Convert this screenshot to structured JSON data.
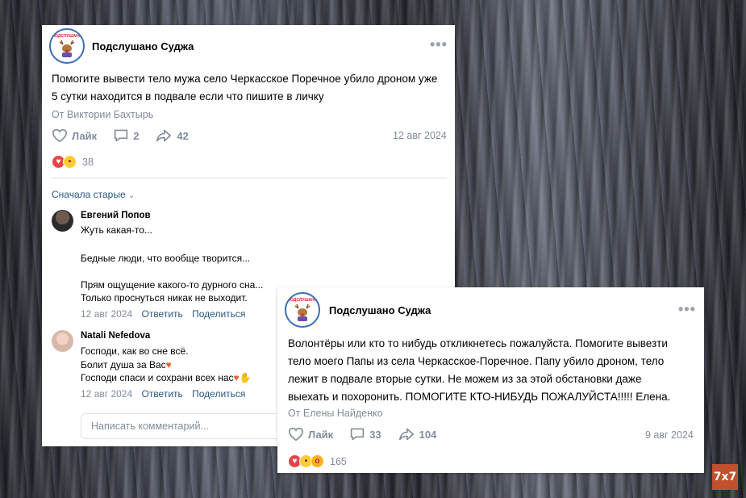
{
  "post1": {
    "group_name": "Подслушано Суджа",
    "logo_text": "ПОДСЛУШАНО",
    "text_lines": [
      "Помогите вывести тело мужа село Черкасское Поречное убило дроном уже",
      "5 сутки находится в подвале если что пишите в личку"
    ],
    "from": "От Виктории Бахтырь",
    "like_label": "Лайк",
    "comments": "2",
    "shares": "42",
    "date": "12 авг 2024",
    "reaction_count": "38",
    "sort_label": "Сначала старые",
    "comment_items": [
      {
        "author": "Евгений Попов",
        "lines": [
          "Жуть какая-то...",
          "",
          "Бедные люди, что вообще творится...",
          "",
          "Прям ощущение какого-то дурного сна...",
          "Только проснуться никак не выходит."
        ],
        "date": "12 авг 2024",
        "reply": "Ответить",
        "share": "Поделиться"
      },
      {
        "author": "Natali Nefedova",
        "lines": [
          "Господи, как во сне всё.",
          "Болит душа за Вас",
          "Господи спаси и сохрани всех нас"
        ],
        "date": "12 авг 2024",
        "reply": "Ответить",
        "share": "Поделиться"
      }
    ],
    "comment_placeholder": "Написать комментарий..."
  },
  "post2": {
    "group_name": "Подслушано Суджа",
    "logo_text": "ПОДСЛУШАНО",
    "text_lines": [
      "Волонтёры или кто то нибудь откликнетесь пожалуйста. Помогите вывезти",
      "тело моего Папы из села Черкасское-Поречное. Папу убило дроном, тело",
      "лежит в подвале вторые сутки. Не можем из за этой обстановки даже",
      "выехать и похоронить. ПОМОГИТЕ КТО-НИБУДЬ ПОЖАЛУЙСТА!!!!! Елена."
    ],
    "from": "От Елены Найденко",
    "like_label": "Лайк",
    "comments": "33",
    "shares": "104",
    "date": "9 авг 2024",
    "reaction_count": "165"
  },
  "watermark": "7x7",
  "colors": {
    "link": "#2a5885",
    "muted": "#818c99",
    "heart": "#e64646",
    "watermark_bg": "#c0502e"
  }
}
